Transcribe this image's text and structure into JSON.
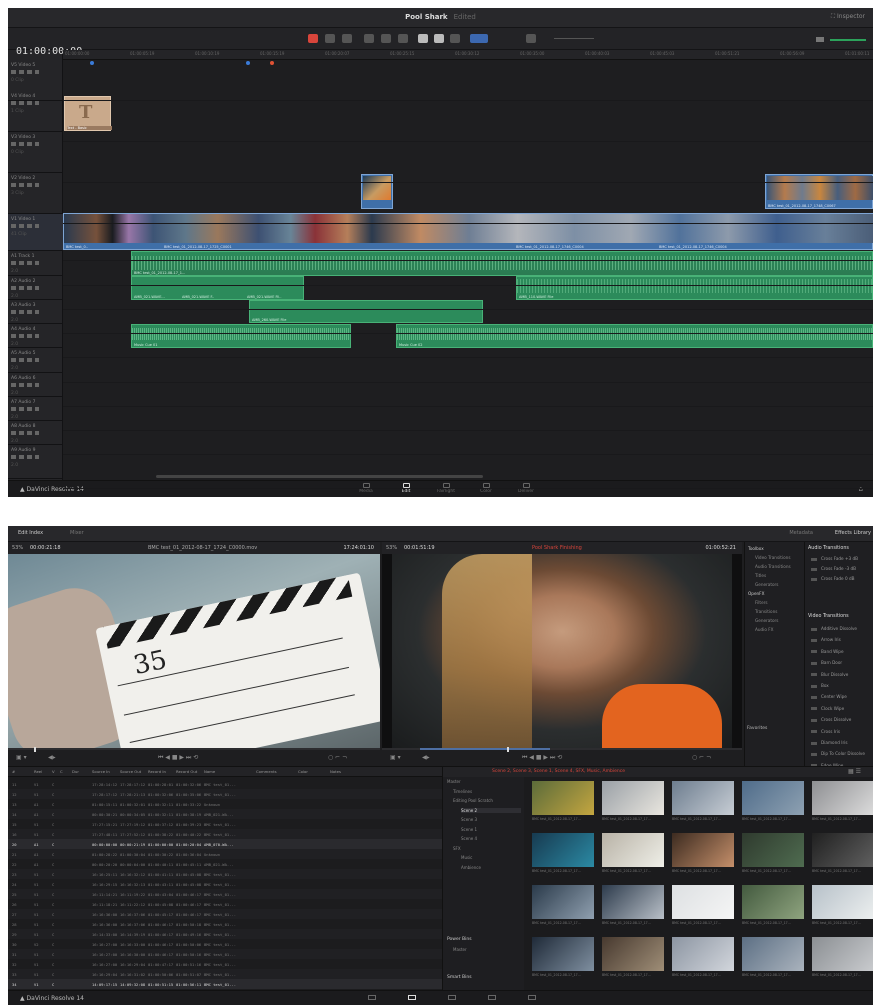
{
  "edit": {
    "title": "Pool Shark",
    "edited": "Edited",
    "timecode": "01:00:00:00",
    "ruler_ticks": [
      "01:00:00:00",
      "01:00:05:19",
      "01:00:10:19",
      "01:00:15:19",
      "01:00:20:07",
      "01:00:25:15",
      "01:00:30:12",
      "01:00:35:00",
      "01:00:40:03",
      "01:00:45:03",
      "01:00:51:21",
      "01:00:56:09",
      "01:01:00:11"
    ],
    "tracks": [
      {
        "name": "V5  Video 5",
        "sub": "0 Clip"
      },
      {
        "name": "V4  Video 4",
        "sub": "1 Clip"
      },
      {
        "name": "V3  Video 3",
        "sub": "0 Clip"
      },
      {
        "name": "V2  Video 2",
        "sub": "3 Clip"
      },
      {
        "name": "V1  Video 1",
        "sub": "41 Clip"
      },
      {
        "name": "A1  Track 1",
        "sub": "2.0"
      },
      {
        "name": "A2  Audio 2",
        "sub": "2.0"
      },
      {
        "name": "A3  Audio 3",
        "sub": "2.0"
      },
      {
        "name": "A4  Audio 4",
        "sub": "2.0"
      },
      {
        "name": "A5  Audio 5",
        "sub": "2.0"
      },
      {
        "name": "A6  Audio 6",
        "sub": "2.0"
      },
      {
        "name": "A7  Audio 7",
        "sub": "2.0"
      },
      {
        "name": "A8  Audio 8",
        "sub": "2.0"
      },
      {
        "name": "A9  Audio 9",
        "sub": "2.0"
      }
    ],
    "clips": {
      "title_clip": "Text - Basic",
      "v2_label": "BMC test_01_2012-08-17_1748_C0067",
      "v1_a": "BMC test_0..",
      "v1_b": "BMC test_01_2012-08-17_1725_C0001",
      "v1_c": "BMC test_01_2012-08-17_1746_C0004",
      "v1_d": "BMC test_01_2012-08-17_1746_C0004",
      "a_label": "BMC test_01_2012-08-17_1...",
      "a2_a": "AMB_021-WAVE...",
      "a2_b": "AMB_021-WAVE F..",
      "a2_c": "AMB_021-WAVE Fil..",
      "a2_d": "AMB_110-WAVE File",
      "a3": "AMB_260-WAVE File",
      "a4_a": "Music Cue 01",
      "a4_b": "Music Cue 02"
    },
    "logo": "DaVinci Resolve 14",
    "pages": [
      "Media",
      "Edit",
      "Fairlight",
      "Color",
      "Deliver"
    ]
  },
  "source": {
    "tabs": [
      "Edit Index",
      "Mixer"
    ],
    "right_tabs": [
      "Metadata",
      "Effects Library"
    ],
    "viewer_left": {
      "zoom": "53%",
      "tc": "00:00:21:18",
      "clip": "BMC test_01_2012-08-17_1724_C0000.mov",
      "tc_end": "17:24:01:10"
    },
    "viewer_right": {
      "zoom": "53%",
      "tc": "00:01:51:19",
      "name": "Pool Shark Finishing",
      "tc_end": "01:00:52:21"
    },
    "toolbox": [
      "Toolbox",
      "Video Transitions",
      "Audio Transitions",
      "Titles",
      "Generators",
      "OpenFX",
      "Filters",
      "Transitions",
      "Generators",
      "Audio FX"
    ],
    "favorites": "Favorites",
    "audio_transitions_title": "Audio Transitions",
    "audio_transitions": [
      "Cross Fade +3 dB",
      "Cross Fade -3 dB",
      "Cross Fade 0 dB"
    ],
    "video_transitions_title": "Video Transitions",
    "video_transitions": [
      "Additive Dissolve",
      "Arrow Iris",
      "Band Wipe",
      "Barn Door",
      "Blur Dissolve",
      "Box",
      "Center Wipe",
      "Clock Wipe",
      "Cross Dissolve",
      "Cross Iris",
      "Diamond Iris",
      "Dip To Color Dissolve",
      "Edge Wipe"
    ],
    "edit_index_cols": [
      "#",
      "Reel",
      "V",
      "C",
      "Dur",
      "Source In",
      "Source Out",
      "Record In",
      "Record Out",
      "Name",
      "Comments",
      "Color",
      "Notes"
    ],
    "edit_index_rows": [
      [
        "11",
        "V1",
        "C",
        "",
        "17:28:14:12",
        "17:28:17:12",
        "01:00:28:01",
        "01:00:32:06",
        "BMC test_01..."
      ],
      [
        "12",
        "V1",
        "C",
        "",
        "17:28:17:12",
        "17:28:21:13",
        "01:00:32:06",
        "01:00:35:06",
        "BMC test_01..."
      ],
      [
        "13",
        "A1",
        "C",
        "",
        "01:00:15:11",
        "01:00:32:01",
        "01:00:32:11",
        "01:00:33:22",
        "Unknown"
      ],
      [
        "14",
        "A1",
        "C",
        "",
        "00:00:30:21",
        "00:00:34:05",
        "01:00:32:11",
        "01:00:38:19",
        "AMB_021-WA..."
      ],
      [
        "15",
        "V1",
        "C",
        "",
        "17:27:15:21",
        "17:27:19:12",
        "01:00:37:12",
        "01:00:39:23",
        "BMC test_01..."
      ],
      [
        "16",
        "V1",
        "C",
        "",
        "17:27:48:11",
        "17:27:52:12",
        "01:00:38:22",
        "01:00:40:22",
        "BMC test_01..."
      ],
      [
        "20",
        "A1",
        "C",
        "",
        "00:00:00:00",
        "00:00:21:19",
        "01:00:00:00",
        "01:00:20:04",
        "AMB_070-WA..."
      ],
      [
        "21",
        "A1",
        "C",
        "",
        "01:00:28:22",
        "01:00:30:04",
        "01:00:30:22",
        "01:00:36:04",
        "Unknown"
      ],
      [
        "22",
        "A1",
        "C",
        "",
        "00:00:20:20",
        "00:00:04:00",
        "01:00:40:11",
        "01:00:45:11",
        "AMB_021-WA..."
      ],
      [
        "23",
        "V1",
        "C",
        "",
        "16:16:25:11",
        "16:16:32:12",
        "01:00:41:11",
        "01:00:45:08",
        "BMC test_01..."
      ],
      [
        "24",
        "V1",
        "C",
        "",
        "16:16:29:15",
        "16:16:32:13",
        "01:00:43:11",
        "01:00:45:08",
        "BMC test_01..."
      ],
      [
        "25",
        "V1",
        "C",
        "",
        "16:11:14:21",
        "16:11:19:22",
        "01:00:43:04",
        "01:00:46:17",
        "BMC test_01..."
      ],
      [
        "26",
        "V1",
        "C",
        "",
        "16:11:18:21",
        "16:11:22:12",
        "01:00:45:08",
        "01:00:46:17",
        "BMC test_01..."
      ],
      [
        "27",
        "V1",
        "C",
        "",
        "16:16:36:00",
        "16:16:37:06",
        "01:00:45:17",
        "01:00:46:17",
        "BMC test_01..."
      ],
      [
        "28",
        "V1",
        "C",
        "",
        "16:16:36:00",
        "16:16:37:06",
        "01:00:46:17",
        "01:00:50:18",
        "BMC test_01..."
      ],
      [
        "29",
        "V1",
        "C",
        "",
        "16:14:33:00",
        "16:14:39:19",
        "01:00:46:17",
        "01:00:49:16",
        "BMC test_01..."
      ],
      [
        "30",
        "V2",
        "C",
        "",
        "16:16:27:00",
        "16:16:33:00",
        "01:00:46:17",
        "01:00:50:06",
        "BMC test_01..."
      ],
      [
        "31",
        "V1",
        "C",
        "",
        "16:16:27:00",
        "16:16:30:00",
        "01:00:46:17",
        "01:00:50:16",
        "BMC test_01..."
      ],
      [
        "32",
        "V1",
        "C",
        "",
        "16:16:27:00",
        "16:16:29:04",
        "01:00:47:17",
        "01:00:51:16",
        "BMC test_01..."
      ],
      [
        "33",
        "V1",
        "C",
        "",
        "16:16:29:04",
        "16:16:31:02",
        "01:00:50:06",
        "01:00:51:07",
        "BMC test_01..."
      ],
      [
        "34",
        "V1",
        "C",
        "",
        "14:09:17:15",
        "14:09:32:08",
        "01:00:51:15",
        "01:00:56:11",
        "BMC test_01..."
      ]
    ],
    "bins": [
      "Master",
      "Timelines",
      "Editing Pool Scratch",
      "Scene 2",
      "Scene 3",
      "Scene 1",
      "Scene 4",
      "SFX",
      "Music",
      "Ambience"
    ],
    "power_bins": "Power Bins",
    "power_sub": "Master",
    "smart_bins": "Smart Bins",
    "breadcrumb": "Scene 2, Scene 3, Scene 1, Scene 4, SFX, Music, Ambience",
    "thumb_caption": "BMC test_01_2012-08-17_17...",
    "logo": "DaVinci Resolve 14"
  }
}
